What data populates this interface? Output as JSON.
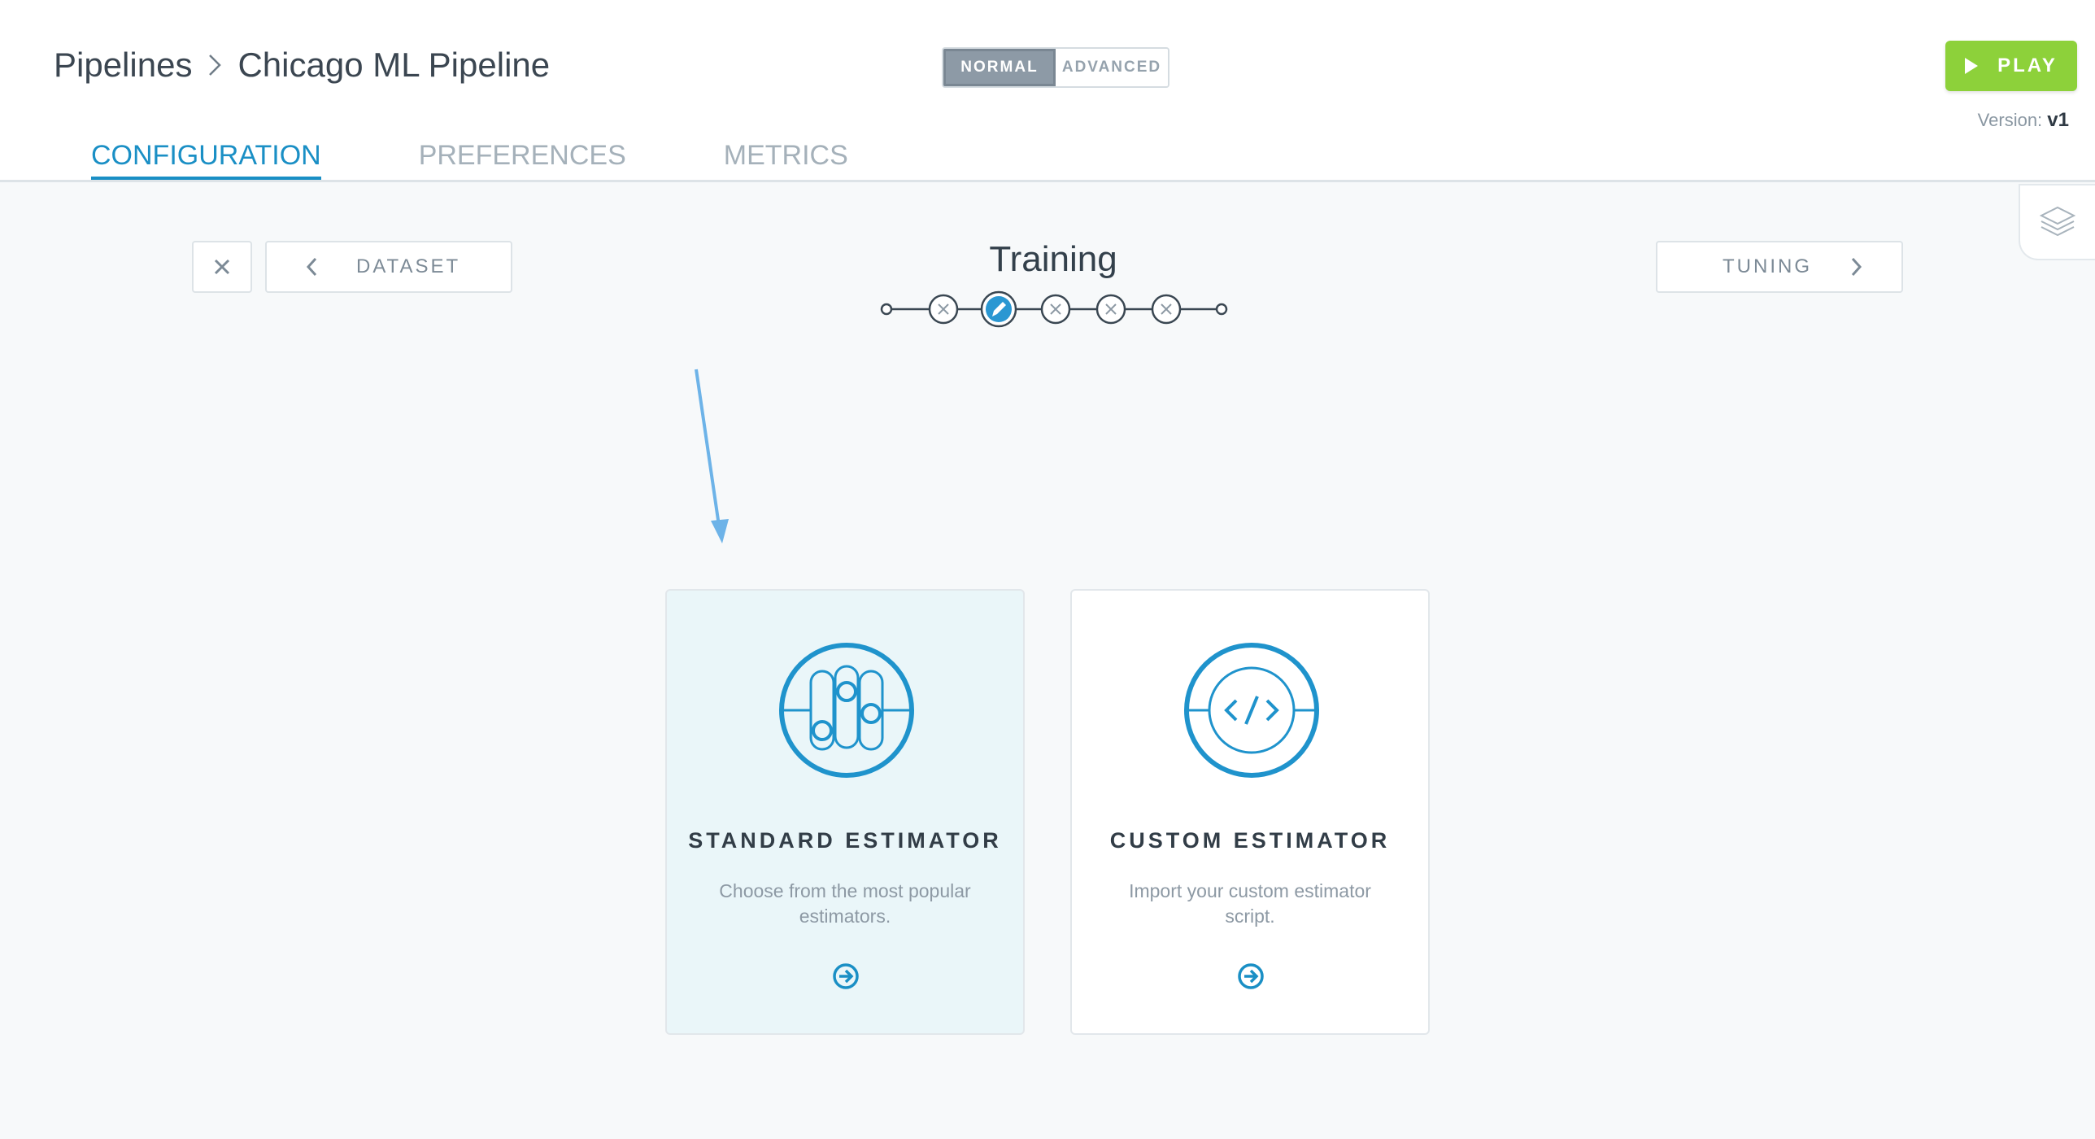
{
  "breadcrumb": {
    "root": "Pipelines",
    "current": "Chicago ML Pipeline"
  },
  "mode_toggle": {
    "normal": "NORMAL",
    "advanced": "ADVANCED",
    "selected": "NORMAL"
  },
  "play": {
    "label": "PLAY"
  },
  "version": {
    "label": "Version:",
    "value": "v1"
  },
  "tabs": [
    {
      "label": "CONFIGURATION",
      "active": true
    },
    {
      "label": "PREFERENCES",
      "active": false
    },
    {
      "label": "METRICS",
      "active": false
    }
  ],
  "step_nav": {
    "prev_label": "DATASET",
    "next_label": "TUNING",
    "current_title": "Training"
  },
  "cards": [
    {
      "title": "STANDARD ESTIMATOR",
      "description": "Choose from the most popular estimators.",
      "icon": "sliders-icon",
      "selected": true
    },
    {
      "title": "CUSTOM ESTIMATOR",
      "description": "Import your custom estimator script.",
      "icon": "code-icon",
      "selected": false
    }
  ],
  "colors": {
    "accent": "#1a8fc5",
    "play": "#8dd13a",
    "annotation_arrow": "#6db3e8",
    "selected_card_bg": "#eaf6f9"
  }
}
